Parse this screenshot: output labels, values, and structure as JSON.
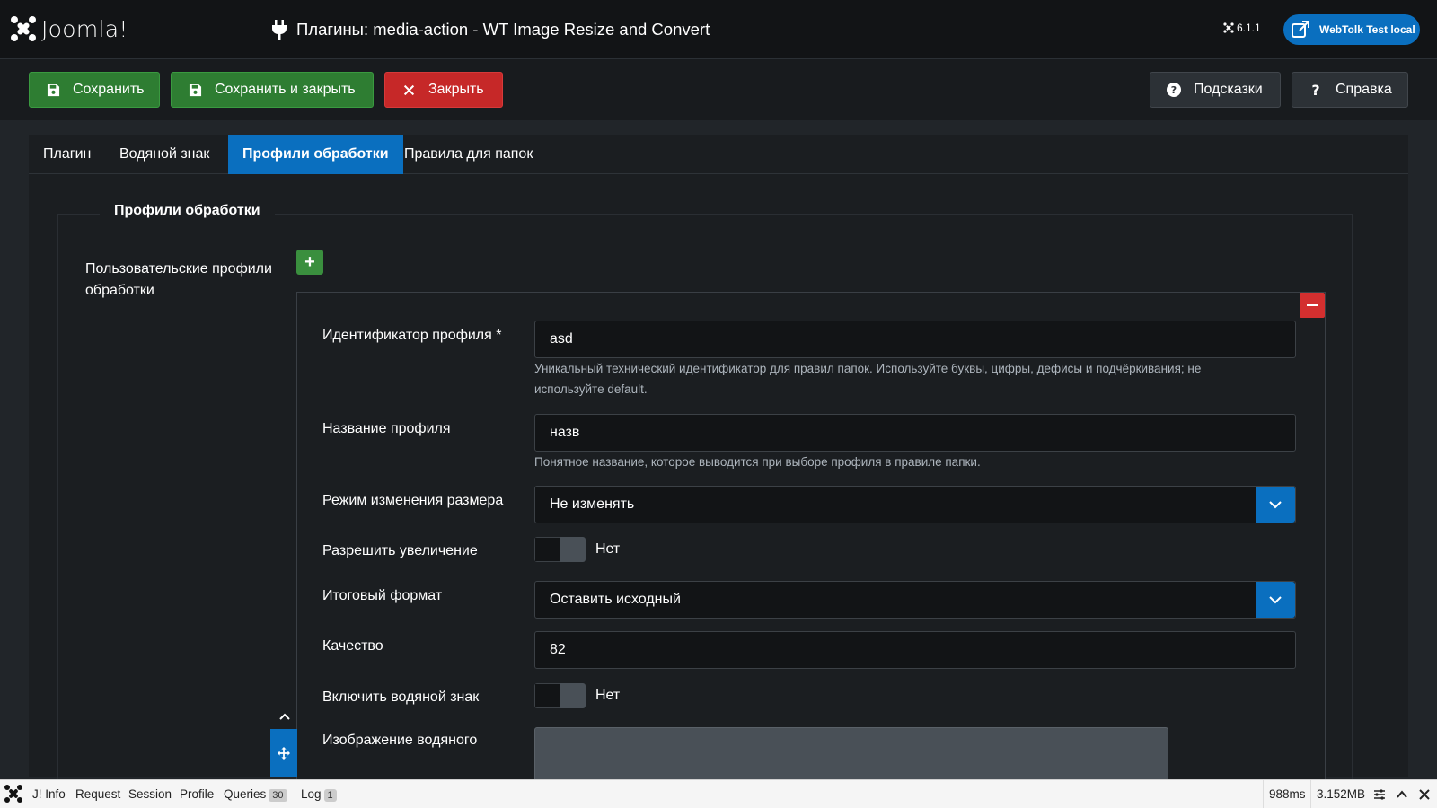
{
  "header": {
    "logo_text": "Joomla!",
    "title": "Плагины: media-action - WT Image Resize and Convert",
    "version": "6.1.1",
    "site_button": "WebTolk Test local"
  },
  "toolbar": {
    "save": "Сохранить",
    "save_close": "Сохранить и закрыть",
    "close": "Закрыть",
    "hints": "Подсказки",
    "help": "Справка"
  },
  "tabs": [
    "Плагин",
    "Водяной знак",
    "Профили обработки",
    "Правила для папок"
  ],
  "active_tab": "Профили обработки",
  "fieldset": {
    "legend": "Профили обработки",
    "group_label": "Пользовательские профили обработки",
    "add_button": "+"
  },
  "profile": {
    "id_label": "Идентификатор профиля *",
    "id_value": "asd",
    "id_hint": "Уникальный технический идентификатор для правил папок. Используйте буквы, цифры, дефисы и подчёркивания; не используйте default.",
    "name_label": "Название профиля",
    "name_value": "назв",
    "name_hint": "Понятное название, которое выводится при выборе профиля в правиле папки.",
    "resize_label": "Режим изменения размера",
    "resize_value": "Не изменять",
    "upscale_label": "Разрешить увеличение",
    "upscale_value": "Нет",
    "format_label": "Итоговый формат",
    "format_value": "Оставить исходный",
    "quality_label": "Качество",
    "quality_value": "82",
    "watermark_label": "Включить водяной знак",
    "watermark_value": "Нет",
    "wm_image_label": "Изображение водяного знака"
  },
  "debugbar": {
    "info": "J! Info",
    "request": "Request",
    "session": "Session",
    "profile": "Profile",
    "queries": "Queries",
    "queries_count": "30",
    "log": "Log",
    "log_count": "1",
    "time": "988ms",
    "memory": "3.152MB"
  },
  "colors": {
    "primary": "#0a6fbf",
    "success": "#2e7d32",
    "danger": "#c62828"
  }
}
